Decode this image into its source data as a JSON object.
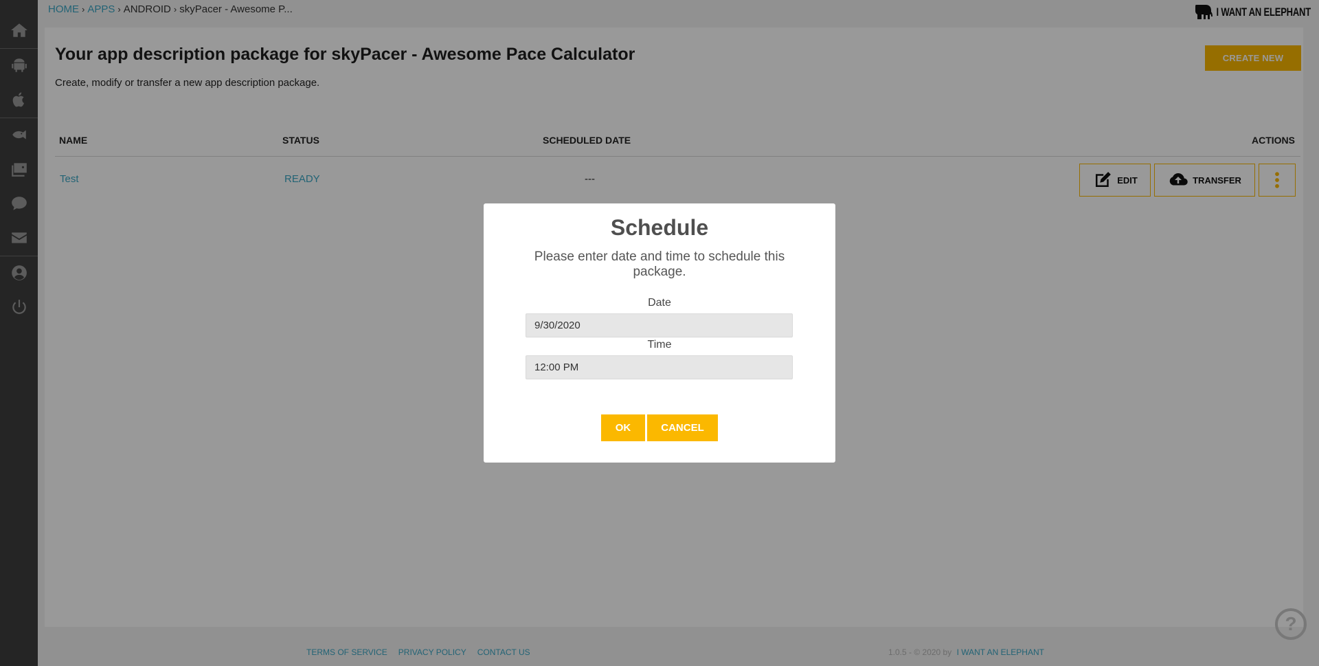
{
  "breadcrumb": {
    "home": "HOME",
    "apps": "APPS",
    "platform": "ANDROID",
    "current": "skyPacer - Awesome P..."
  },
  "logo": {
    "text": "I WANT AN ELEPHANT"
  },
  "sidebar": {
    "items": [
      "home-icon",
      "android-icon",
      "apple-icon",
      "fish-icon",
      "media-icon",
      "chat-icon",
      "mail-icon",
      "user-icon",
      "power-icon"
    ]
  },
  "page": {
    "title_prefix": "Your app description package for",
    "title_app": "skyPacer - Awesome Pace Calculator",
    "subtitle": "Create, modify or transfer a new app description package.",
    "create_button": "CREATE NEW"
  },
  "table": {
    "headers": {
      "name": "NAME",
      "status": "STATUS",
      "scheduled": "SCHEDULED DATE",
      "actions": "ACTIONS"
    },
    "rows": [
      {
        "name": "Test",
        "status": "READY",
        "scheduled": "---"
      }
    ],
    "actions": {
      "edit": "EDIT",
      "transfer": "TRANSFER"
    }
  },
  "footer": {
    "terms": "TERMS OF SERVICE",
    "privacy": "PRIVACY POLICY",
    "contact": "CONTACT US",
    "version": "1.0.5 - © 2020 by",
    "company": "I WANT AN ELEPHANT",
    "help": "?"
  },
  "modal": {
    "title": "Schedule",
    "text": "Please enter date and time to schedule this package.",
    "date_label": "Date",
    "date_value": "9/30/2020",
    "time_label": "Time",
    "time_value": "12:00 PM",
    "ok": "OK",
    "cancel": "CANCEL"
  },
  "colors": {
    "accent": "#fbb800",
    "link": "#3aa6c4",
    "sidebar": "#3f3f3f"
  }
}
